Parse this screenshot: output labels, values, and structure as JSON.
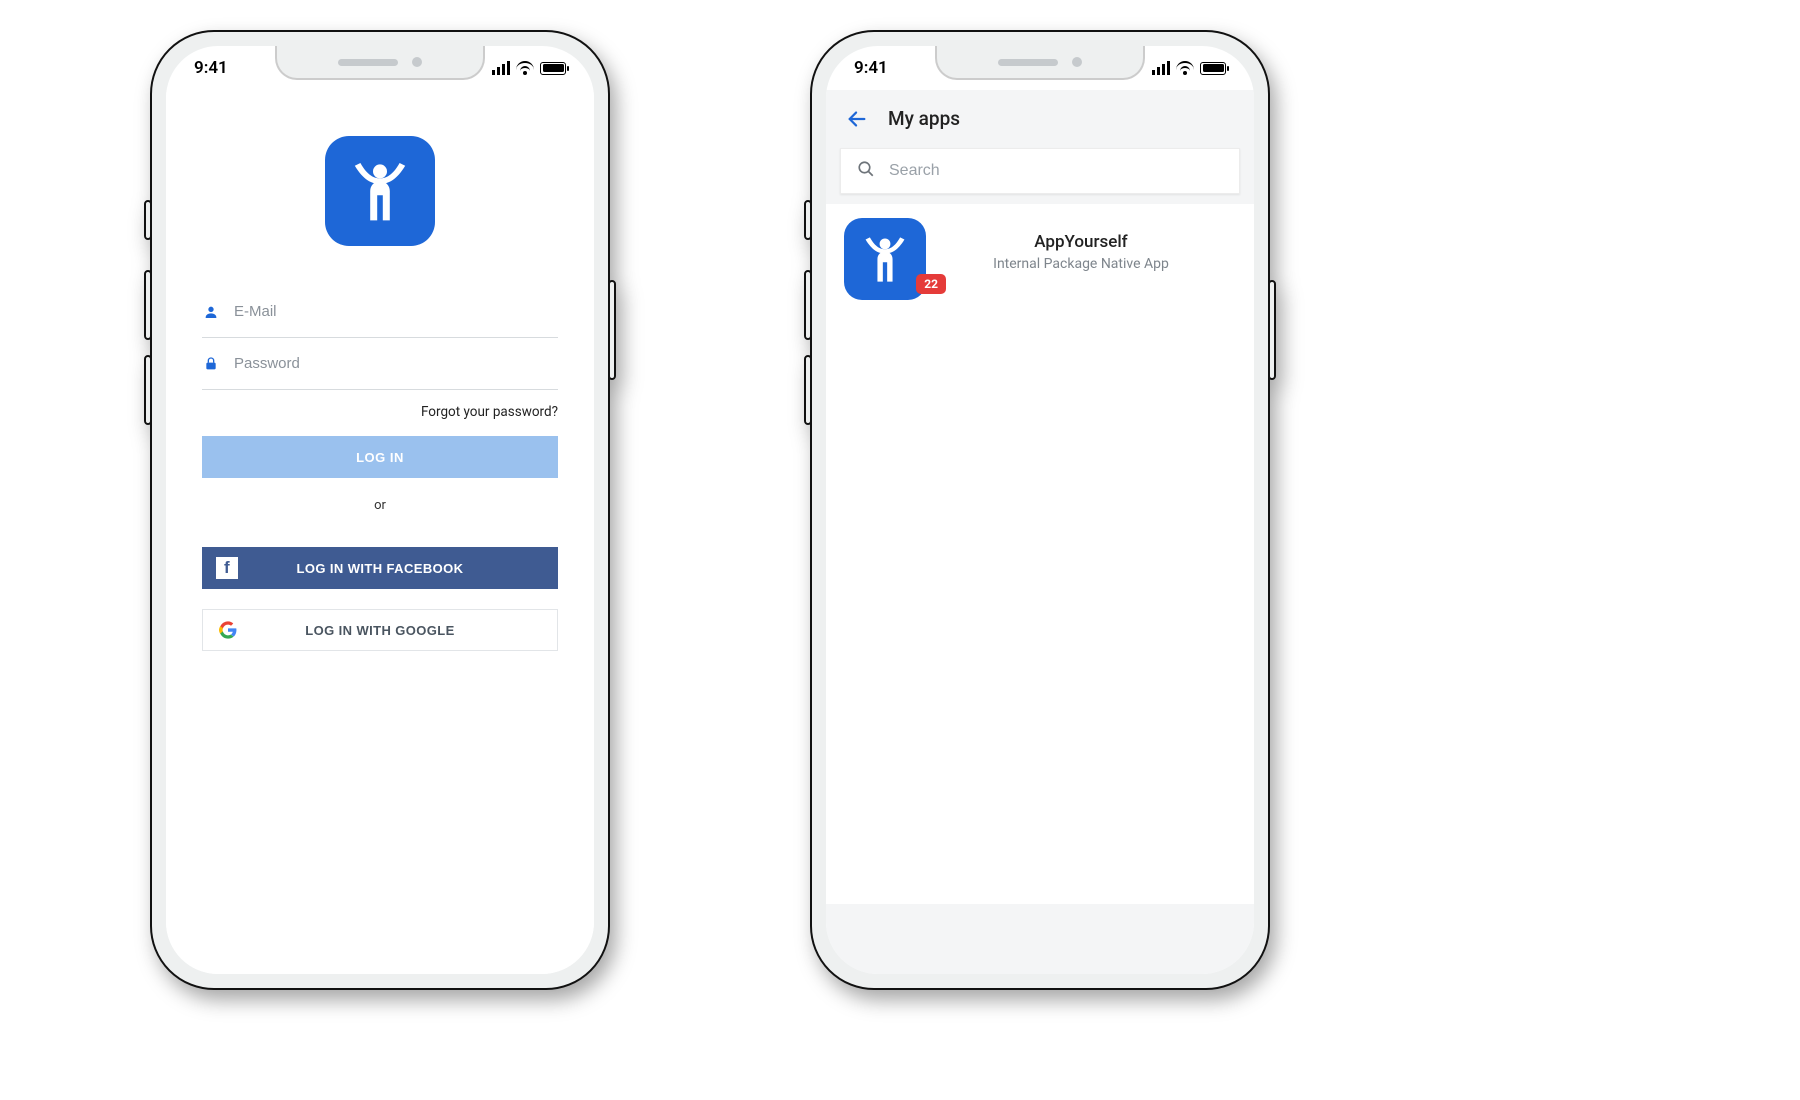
{
  "status": {
    "time": "9:41"
  },
  "login": {
    "email_placeholder": "E-Mail",
    "password_placeholder": "Password",
    "forgot": "Forgot your password?",
    "login_btn": "LOG IN",
    "or": "or",
    "fb_btn": "LOG IN WITH FACEBOOK",
    "gg_btn": "LOG IN WITH GOOGLE"
  },
  "myapps": {
    "title": "My apps",
    "search_placeholder": "Search",
    "items": [
      {
        "name": "AppYourself",
        "subtitle": "Internal Package Native App",
        "badge": "22"
      }
    ]
  }
}
